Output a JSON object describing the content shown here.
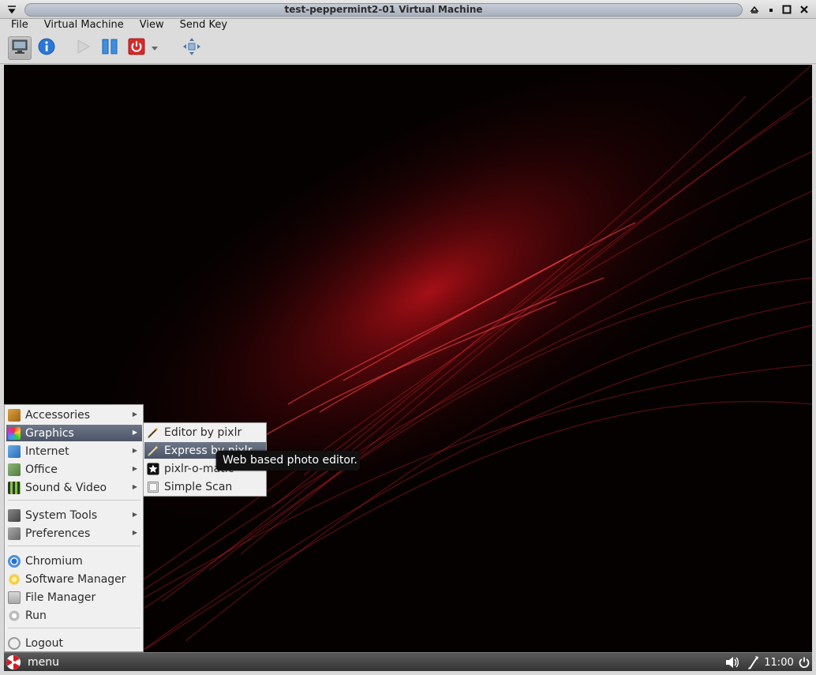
{
  "window": {
    "title": "test-peppermint2-01 Virtual Machine"
  },
  "menubar": {
    "items": [
      "File",
      "Virtual Machine",
      "View",
      "Send Key"
    ]
  },
  "toolbar": {
    "icons": [
      "monitor-icon",
      "info-icon",
      "play-icon",
      "pause-icon",
      "power-icon",
      "dropdown-arrow-icon",
      "fullscreen-icon"
    ]
  },
  "startmenu": {
    "categories": [
      "Accessories",
      "Graphics",
      "Internet",
      "Office",
      "Sound & Video"
    ],
    "system": [
      "System Tools",
      "Preferences"
    ],
    "apps": [
      "Chromium",
      "Software Manager",
      "File Manager",
      "Run"
    ],
    "logout": "Logout",
    "highlighted": "Graphics"
  },
  "submenu": {
    "items": [
      "Editor by pixlr",
      "Express by pixlr",
      "pixlr-o-matic",
      "Simple Scan"
    ],
    "highlighted": "Express by pixlr"
  },
  "tooltip": {
    "text": "Web based photo editor."
  },
  "panel": {
    "menu_label": "menu",
    "clock": "11:00"
  },
  "colors": {
    "wallpaper_glow": "#c2121a",
    "highlight": "#5a6476"
  }
}
